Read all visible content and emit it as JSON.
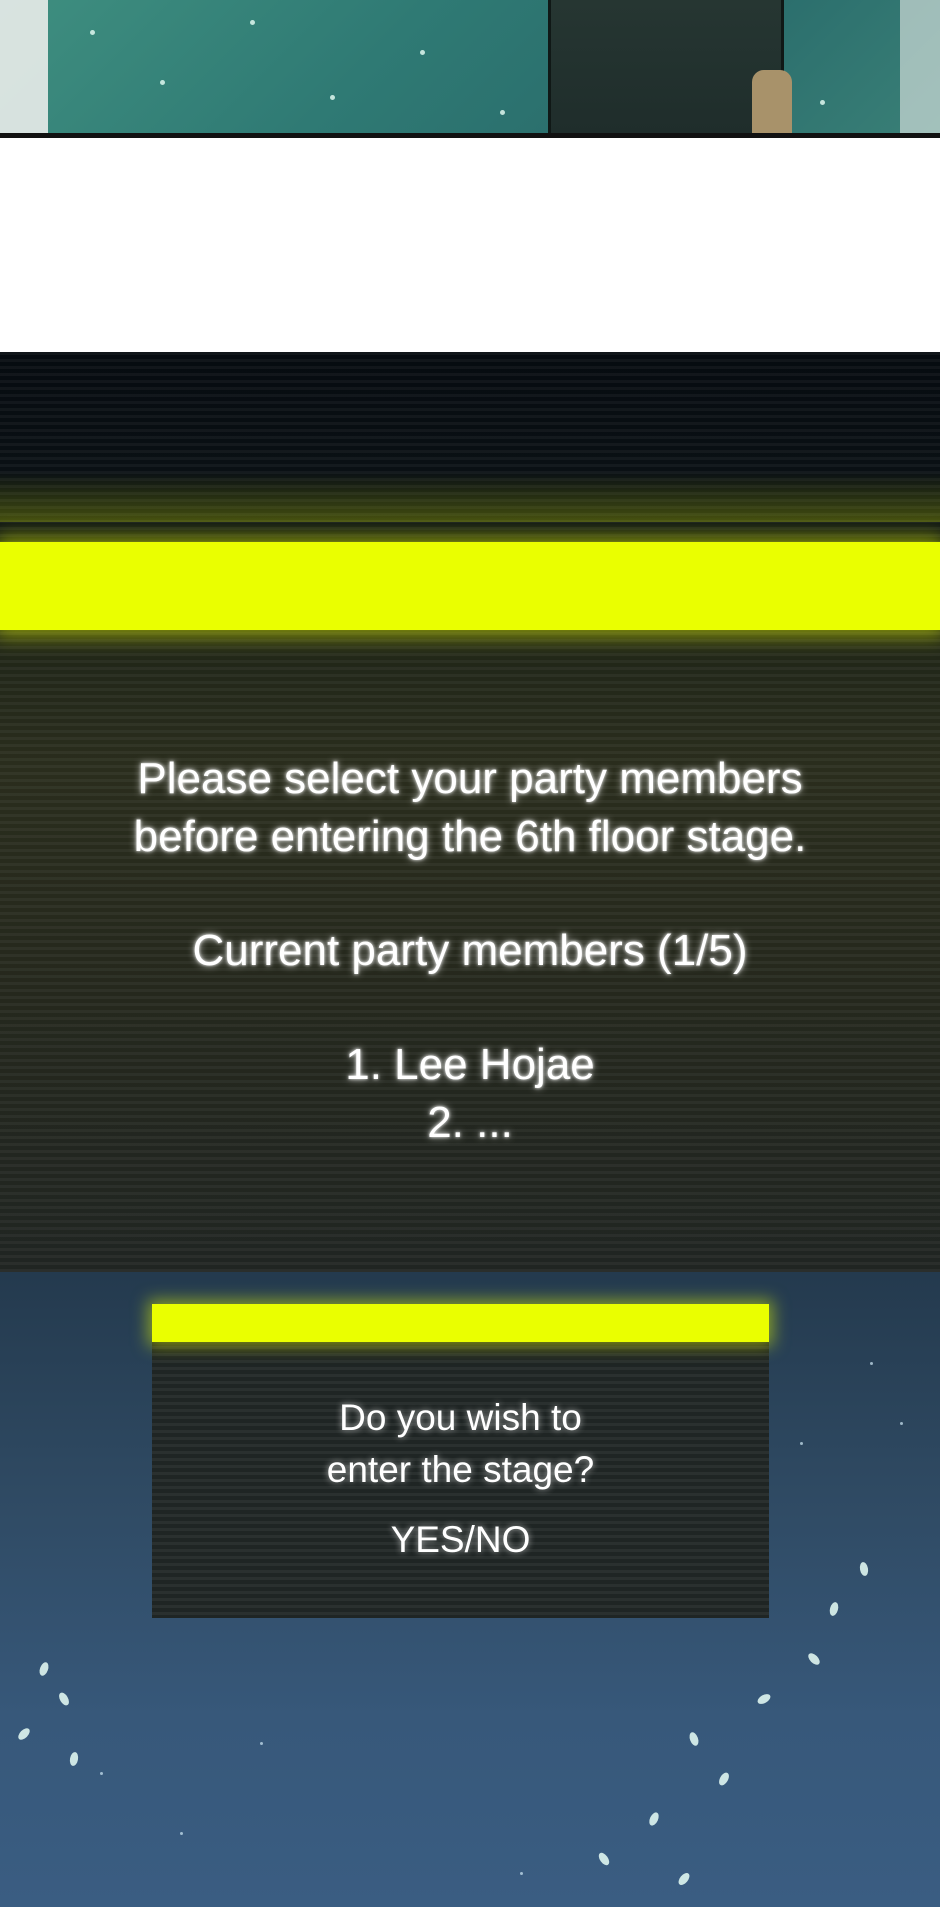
{
  "system_window": {
    "line1": "Please select your party members",
    "line2": "before entering the 6th floor stage.",
    "line3": "Current party members (1/5)",
    "member1": "1. Lee Hojae",
    "member2": "2. ..."
  },
  "dialog": {
    "question_line1": "Do you wish to",
    "question_line2": "enter the stage?",
    "options": "YES/NO"
  },
  "colors": {
    "accent_yellow": "#eaff00",
    "window_dark": "#25281d",
    "night_blue": "#37587a"
  }
}
